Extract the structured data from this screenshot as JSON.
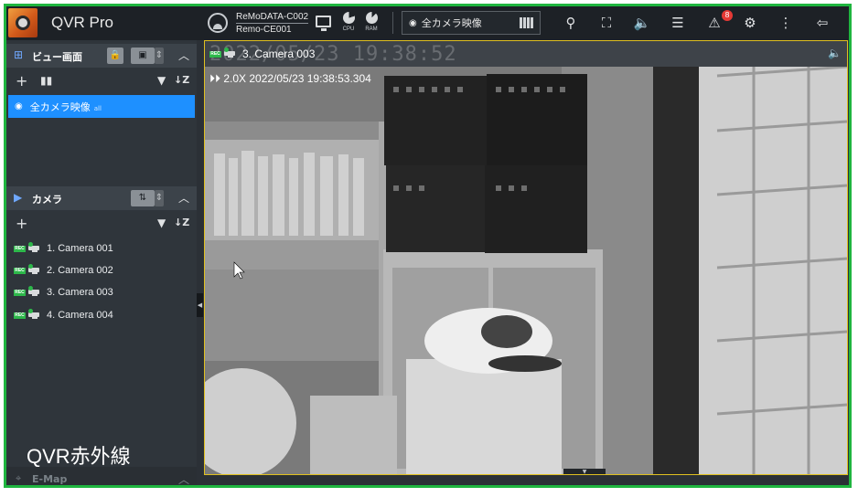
{
  "app": {
    "title": "QVR Pro"
  },
  "topbar": {
    "user_line1": "ReMoDATA-C002",
    "user_line2": "Remo-CE001",
    "cpu_label": "CPU",
    "ram_label": "RAM",
    "view_select": "全カメラ映像",
    "notification_count": "8"
  },
  "sidebar": {
    "views_panel": {
      "title": "ビュー画面"
    },
    "view_items": [
      {
        "label": "全カメラ映像",
        "sub": "all"
      }
    ],
    "cameras_panel": {
      "title": "カメラ"
    },
    "cameras": [
      {
        "label": "1. Camera 001",
        "rec": "REC"
      },
      {
        "label": "2. Camera 002",
        "rec": "REC"
      },
      {
        "label": "3. Camera 003",
        "rec": "REC"
      },
      {
        "label": "4. Camera 004",
        "rec": "REC"
      }
    ],
    "overlay_label": "QVR赤外線",
    "emap": {
      "title": "E-Map"
    }
  },
  "camera_view": {
    "title": "3. Camera 003",
    "rec": "REC",
    "ghost_time": "2022/05/23 19:38:52",
    "playback_info": "⏵⏵ 2.0X  2022/05/23 19:38:53.304"
  }
}
